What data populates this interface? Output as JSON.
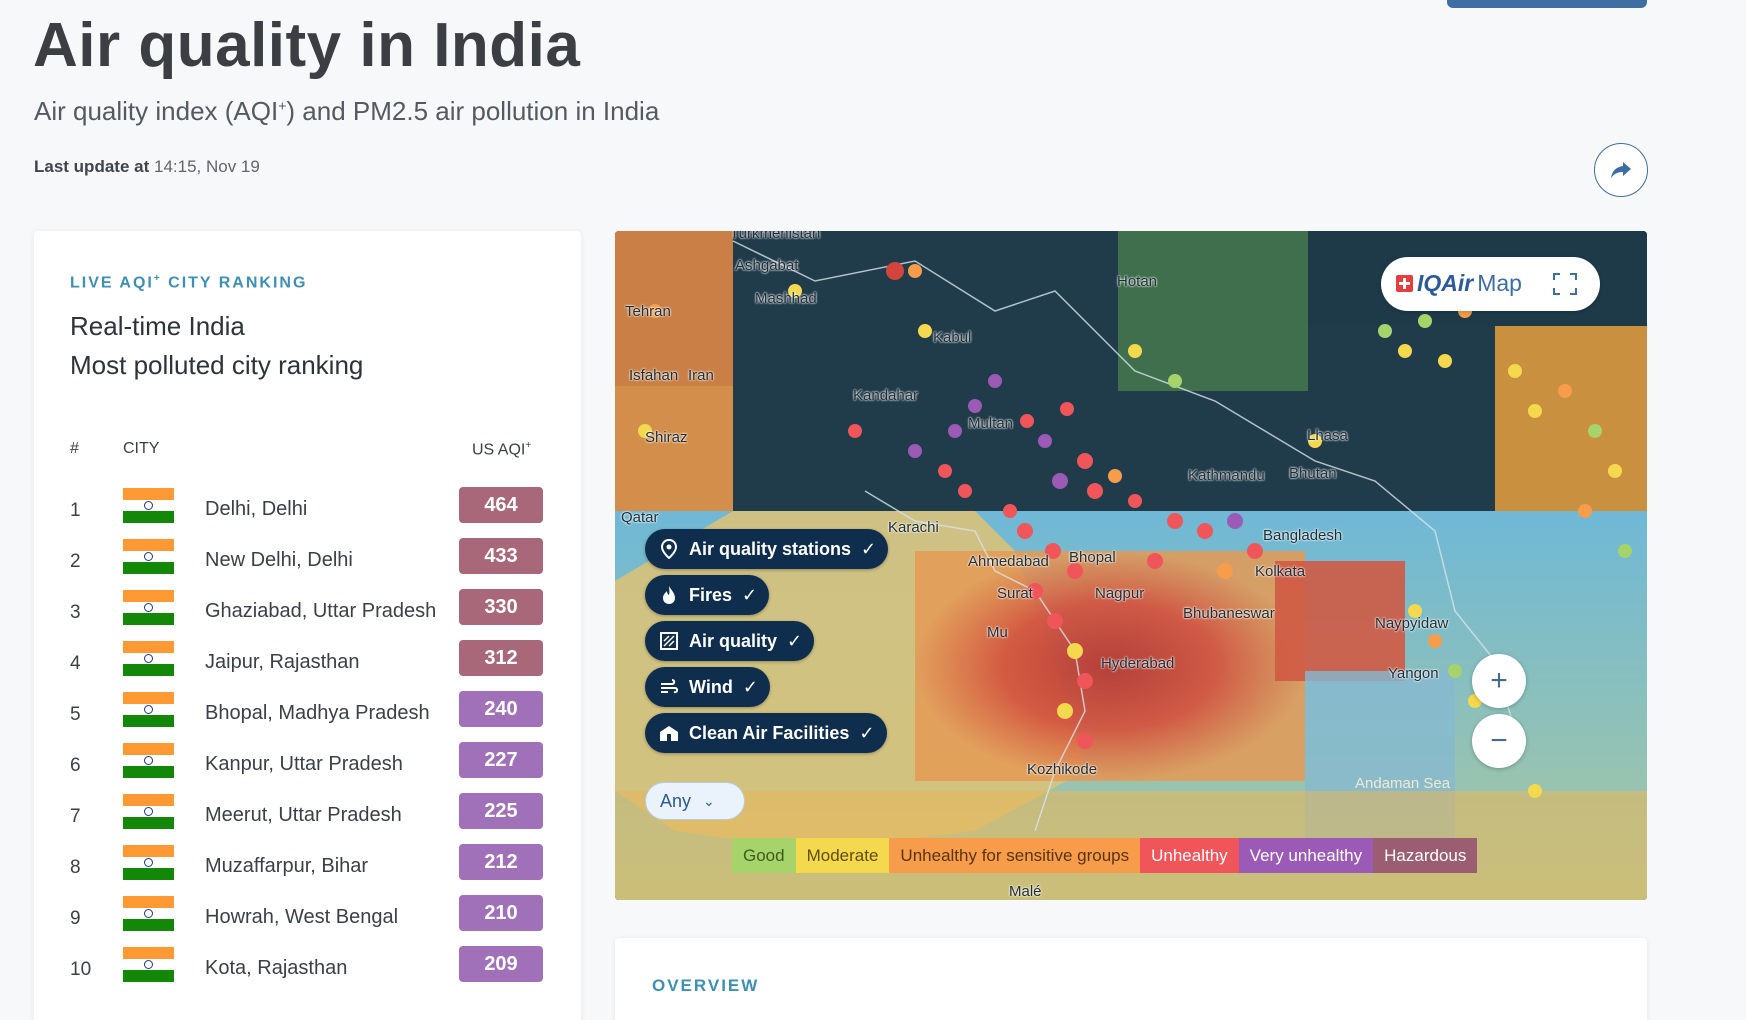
{
  "header": {
    "title": "Air quality in India",
    "subtitle_pre": "Air quality index (AQI",
    "subtitle_sup": "+",
    "subtitle_post": ") and PM2.5 air pollution in India",
    "last_update_label": "Last update at",
    "last_update_value": "14:15, Nov 19"
  },
  "ranking": {
    "eyebrow": "LIVE AQI",
    "eyebrow_sup": "+",
    "eyebrow_post": " CITY RANKING",
    "title_line1": "Real-time India",
    "title_line2": "Most polluted city ranking",
    "col_rank": "#",
    "col_city": "CITY",
    "col_aqi": "US AQI",
    "col_aqi_sup": "+",
    "rows": [
      {
        "rank": "1",
        "city": "Delhi, Delhi",
        "aqi": "464",
        "color": "#a9687a"
      },
      {
        "rank": "2",
        "city": "New Delhi, Delhi",
        "aqi": "433",
        "color": "#a9687a"
      },
      {
        "rank": "3",
        "city": "Ghaziabad, Uttar Pradesh",
        "aqi": "330",
        "color": "#a9687a"
      },
      {
        "rank": "4",
        "city": "Jaipur, Rajasthan",
        "aqi": "312",
        "color": "#a9687a"
      },
      {
        "rank": "5",
        "city": "Bhopal, Madhya Pradesh",
        "aqi": "240",
        "color": "#a070b8"
      },
      {
        "rank": "6",
        "city": "Kanpur, Uttar Pradesh",
        "aqi": "227",
        "color": "#a070b8"
      },
      {
        "rank": "7",
        "city": "Meerut, Uttar Pradesh",
        "aqi": "225",
        "color": "#a070b8"
      },
      {
        "rank": "8",
        "city": "Muzaffarpur, Bihar",
        "aqi": "212",
        "color": "#a070b8"
      },
      {
        "rank": "9",
        "city": "Howrah, West Bengal",
        "aqi": "210",
        "color": "#a070b8"
      },
      {
        "rank": "10",
        "city": "Kota, Rajasthan",
        "aqi": "209",
        "color": "#a070b8"
      }
    ]
  },
  "map": {
    "brand_name": "IQAir",
    "brand_suffix": "Map",
    "layers": {
      "stations": "Air quality stations",
      "fires": "Fires",
      "air_quality": "Air quality",
      "wind": "Wind",
      "facilities": "Clean Air Facilities"
    },
    "filter_value": "Any",
    "legend": [
      {
        "label": "Good",
        "bg": "#a7d36b",
        "fg": "#3f5b1e"
      },
      {
        "label": "Moderate",
        "bg": "#f4d84e",
        "fg": "#5e5010"
      },
      {
        "label": "Unhealthy for sensitive groups",
        "bg": "#f79c4b",
        "fg": "#5a3410"
      },
      {
        "label": "Unhealthy",
        "bg": "#f0555a",
        "fg": "#ffffff"
      },
      {
        "label": "Very unhealthy",
        "bg": "#9b5ab5",
        "fg": "#ffffff"
      },
      {
        "label": "Hazardous",
        "bg": "#9b5d72",
        "fg": "#ffffff"
      }
    ],
    "place_labels": {
      "turkmenistan": "Turkmenistan",
      "ashgabat": "Ashgabat",
      "mashhad": "Mashhad",
      "tehran": "Tehran",
      "isfahan": "Isfahan",
      "iran": "Iran",
      "shiraz": "Shiraz",
      "kandahar": "Kandahar",
      "kabul": "Kabul",
      "multan": "Multan",
      "karachi": "Karachi",
      "ahmedabad": "Ahmedabad",
      "bhopal": "Bhopal",
      "surat": "Surat",
      "mumbai": "Mu",
      "nagpur": "Nagpur",
      "hyderabad": "Hyderabad",
      "kozhikode": "Kozhikode",
      "kathmandu": "Kathmandu",
      "bhutan": "Bhutan",
      "bangladesh": "Bangladesh",
      "kolkata": "Kolkata",
      "bhubaneswar": "Bhubaneswar",
      "naypyidaw": "Naypyidaw",
      "yangon": "Yangon",
      "hotan": "Hotan",
      "lhasa": "Lhasa",
      "andaman_sea": "Andaman Sea",
      "qatar": "Qatar",
      "male": "Malé"
    }
  },
  "overview": {
    "eyebrow": "OVERVIEW"
  }
}
